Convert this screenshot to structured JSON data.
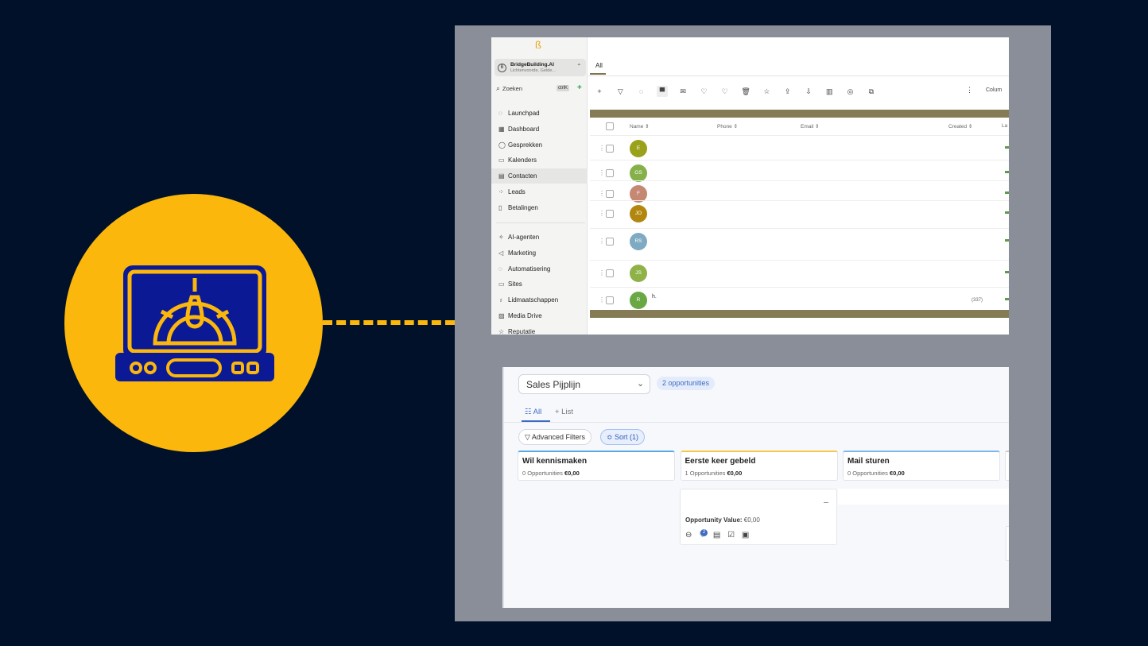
{
  "icon": {
    "name": "dashboard-laptop-icon",
    "circle_color": "#fbb70c",
    "stroke_color": "#fbb70c",
    "screen_color": "#0b1a94"
  },
  "crm": {
    "logo": "ß",
    "account": {
      "name": "BridgeBuilding.AI",
      "location": "Lichtenvoorde, Gelde...",
      "initial": "B"
    },
    "search": {
      "label": "Zoeken",
      "shortcut": "ctrlK"
    },
    "nav": [
      {
        "icon": "launchpad-icon",
        "glyph": "◌",
        "label": "Launchpad"
      },
      {
        "icon": "dashboard-icon",
        "glyph": "▦",
        "label": "Dashboard"
      },
      {
        "icon": "chat-icon",
        "glyph": "◯",
        "label": "Gesprekken"
      },
      {
        "icon": "calendar-icon",
        "glyph": "▭",
        "label": "Kalenders"
      },
      {
        "icon": "contacts-icon",
        "glyph": "▤",
        "label": "Contacten"
      },
      {
        "icon": "leads-icon",
        "glyph": "⁘",
        "label": "Leads"
      },
      {
        "icon": "payments-icon",
        "glyph": "▯",
        "label": "Betalingen"
      }
    ],
    "nav2": [
      {
        "icon": "ai-agents-icon",
        "glyph": "✧",
        "label": "AI-agenten"
      },
      {
        "icon": "marketing-icon",
        "glyph": "◁",
        "label": "Marketing"
      },
      {
        "icon": "automation-icon",
        "glyph": "◌",
        "label": "Automatisering"
      },
      {
        "icon": "sites-icon",
        "glyph": "▭",
        "label": "Sites"
      },
      {
        "icon": "membership-icon",
        "glyph": "♁",
        "label": "Lidmaatschappen"
      },
      {
        "icon": "media-icon",
        "glyph": "▨",
        "label": "Media Drive"
      },
      {
        "icon": "reputation-icon",
        "glyph": "☆",
        "label": "Reputatie"
      }
    ],
    "tab": "All",
    "toolbar_glyphs": [
      "+",
      "▽",
      "◌",
      "▀",
      "✉",
      "♡",
      "♡",
      "🗑",
      "☆",
      "⇪",
      "⇩",
      "▥",
      "◎",
      "⧉"
    ],
    "columns_label": "Colum",
    "headers": {
      "name": "Name ⇕",
      "phone": "Phone ⇕",
      "email": "Email ⇕",
      "created": "Created ⇕",
      "last": "La"
    },
    "rows": [
      {
        "initials": "E",
        "color": "#9aa11a"
      },
      {
        "initials": "GS",
        "color": "#86b04a"
      },
      {
        "initials": "F",
        "color": "#c58872"
      },
      {
        "initials": "JO",
        "color": "#b3870f"
      },
      {
        "initials": "RS",
        "color": "#7eaac2"
      },
      {
        "initials": "JS",
        "color": "#8fb248"
      },
      {
        "initials": "R",
        "color": "#6aa844",
        "name": "h.",
        "created": "(337)"
      }
    ]
  },
  "pipeline": {
    "name": "Sales Pijplijn",
    "count": "2 opportunities",
    "tab_all": "☷ All",
    "tab_list": "+ List",
    "filters": "▽ Advanced Filters",
    "sort": "≎ Sort (1)",
    "stages": [
      {
        "title": "Wil kennismaken",
        "count": "0 Opportunities",
        "value": "€0,00",
        "color": "#5aa9e6"
      },
      {
        "title": "Eerste keer gebeld",
        "count": "1 Opportunities",
        "value": "€0,00",
        "color": "#f3c84b"
      },
      {
        "title": "Mail sturen",
        "count": "0 Opportunities",
        "value": "€0,00",
        "color": "#7fb6ec"
      }
    ],
    "card": {
      "label": "Opportunity Value:",
      "value": "€0,00",
      "badge": "2",
      "icons": "⊖ ♡ ▤ ☑ ▣"
    }
  }
}
